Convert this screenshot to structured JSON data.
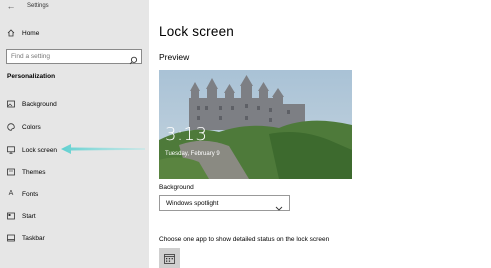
{
  "window": {
    "title": "Settings",
    "back_icon": "back-arrow-icon"
  },
  "sidebar": {
    "home_label": "Home",
    "search": {
      "placeholder": "Find a setting"
    },
    "section_heading": "Personalization",
    "items": [
      {
        "label": "Background",
        "icon": "picture-icon"
      },
      {
        "label": "Colors",
        "icon": "palette-icon"
      },
      {
        "label": "Lock screen",
        "icon": "monitor-icon"
      },
      {
        "label": "Themes",
        "icon": "brush-icon"
      },
      {
        "label": "Fonts",
        "icon": "font-icon"
      },
      {
        "label": "Start",
        "icon": "start-icon"
      },
      {
        "label": "Taskbar",
        "icon": "taskbar-icon"
      }
    ]
  },
  "main": {
    "title": "Lock screen",
    "preview_heading": "Preview",
    "preview": {
      "time": "3:13",
      "date": "Tuesday, February 9"
    },
    "background_label": "Background",
    "background_value": "Windows spotlight",
    "status_label": "Choose one app to show detailed status on the lock screen"
  },
  "colors": {
    "sidebar_bg": "#e6e6e6",
    "annotation_arrow": "#5fd0d0"
  }
}
